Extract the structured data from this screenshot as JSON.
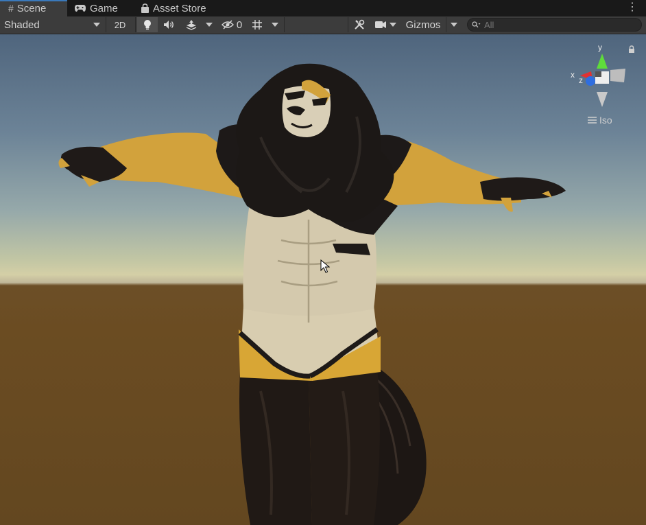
{
  "tabs": [
    {
      "label": "Scene",
      "icon": "hash-icon",
      "active": true
    },
    {
      "label": "Game",
      "icon": "gamepad-icon",
      "active": false
    },
    {
      "label": "Asset Store",
      "icon": "shopping-bag-icon",
      "active": false
    }
  ],
  "toolbar": {
    "draw_mode": "Shaded",
    "mode_2d": "2D",
    "hidden_count": "0",
    "gizmos": "Gizmos",
    "search_placeholder": "All"
  },
  "gizmo": {
    "axis_y": "y",
    "axis_x": "x",
    "axis_z": "z",
    "projection": "Iso"
  },
  "colors": {
    "accent": "#3a79bb",
    "sky_top": "#4f657d",
    "horizon": "#d4cfa6",
    "ground": "#6b4c22"
  }
}
